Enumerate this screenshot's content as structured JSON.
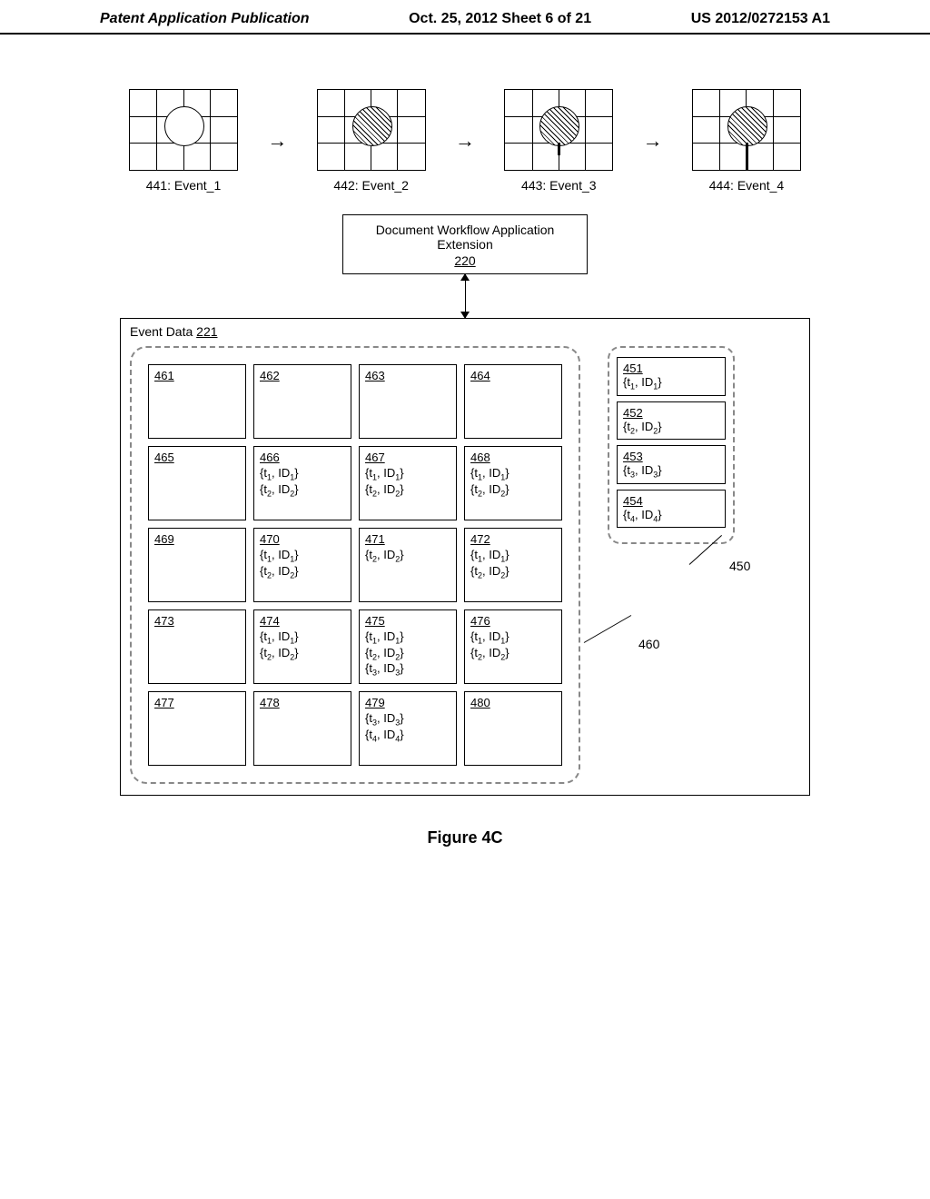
{
  "header": {
    "left": "Patent Application Publication",
    "center": "Oct. 25, 2012  Sheet 6 of 21",
    "right": "US 2012/0272153 A1"
  },
  "events": [
    {
      "label": "441: Event_1",
      "hatched": false,
      "stem": "none"
    },
    {
      "label": "442: Event_2",
      "hatched": true,
      "stem": "none"
    },
    {
      "label": "443: Event_3",
      "hatched": true,
      "stem": "short"
    },
    {
      "label": "444: Event_4",
      "hatched": true,
      "stem": "long"
    }
  ],
  "workflow": {
    "title": "Document Workflow Application Extension",
    "number": "220"
  },
  "event_data": {
    "title": "Event Data",
    "number": "221"
  },
  "cells460": [
    [
      {
        "num": "461",
        "rows": []
      },
      {
        "num": "462",
        "rows": []
      },
      {
        "num": "463",
        "rows": []
      },
      {
        "num": "464",
        "rows": []
      }
    ],
    [
      {
        "num": "465",
        "rows": []
      },
      {
        "num": "466",
        "rows": [
          "{t₁, ID₁}",
          "{t₂, ID₂}"
        ]
      },
      {
        "num": "467",
        "rows": [
          "{t₁, ID₁}",
          "{t₂, ID₂}"
        ]
      },
      {
        "num": "468",
        "rows": [
          "{t₁, ID₁}",
          "{t₂, ID₂}"
        ]
      }
    ],
    [
      {
        "num": "469",
        "rows": []
      },
      {
        "num": "470",
        "rows": [
          "{t₁, ID₁}",
          "{t₂, ID₂}"
        ]
      },
      {
        "num": "471",
        "rows": [
          "{t₂, ID₂}"
        ]
      },
      {
        "num": "472",
        "rows": [
          "{t₁, ID₁}",
          "{t₂, ID₂}"
        ]
      }
    ],
    [
      {
        "num": "473",
        "rows": []
      },
      {
        "num": "474",
        "rows": [
          "{t₁, ID₁}",
          "{t₂, ID₂}"
        ]
      },
      {
        "num": "475",
        "rows": [
          "{t₁, ID₁}",
          "{t₂, ID₂}",
          "{t₃, ID₃}"
        ]
      },
      {
        "num": "476",
        "rows": [
          "{t₁, ID₁}",
          "{t₂, ID₂}"
        ]
      }
    ],
    [
      {
        "num": "477",
        "rows": []
      },
      {
        "num": "478",
        "rows": []
      },
      {
        "num": "479",
        "rows": [
          "{t₃, ID₃}",
          "{t₄, ID₄}"
        ]
      },
      {
        "num": "480",
        "rows": []
      }
    ]
  ],
  "cells450": [
    {
      "num": "451",
      "rows": [
        "{t₁, ID₁}"
      ]
    },
    {
      "num": "452",
      "rows": [
        "{t₂, ID₂}"
      ]
    },
    {
      "num": "453",
      "rows": [
        "{t₃, ID₃}"
      ]
    },
    {
      "num": "454",
      "rows": [
        "{t₄, ID₄}"
      ]
    }
  ],
  "callouts": {
    "c460": "460",
    "c450": "450"
  },
  "figure_caption": "Figure 4C",
  "chart_data": {
    "type": "table",
    "description": "Patent figure 4C: four sequential event snapshots (441–444) showing a circle on a 4×3 grid, a Document Workflow Application Extension box (220) linked to an Event Data container (221). The container holds a dashed 4×5 grid of cells (460: cells 461–480) and a dashed vertical list (450: cells 451–454). Each cell lists tuples {t_i, ID_i}.",
    "region_460_cells": [
      {
        "id": 461,
        "tuples": []
      },
      {
        "id": 462,
        "tuples": []
      },
      {
        "id": 463,
        "tuples": []
      },
      {
        "id": 464,
        "tuples": []
      },
      {
        "id": 465,
        "tuples": []
      },
      {
        "id": 466,
        "tuples": [
          [
            1,
            1
          ],
          [
            2,
            2
          ]
        ]
      },
      {
        "id": 467,
        "tuples": [
          [
            1,
            1
          ],
          [
            2,
            2
          ]
        ]
      },
      {
        "id": 468,
        "tuples": [
          [
            1,
            1
          ],
          [
            2,
            2
          ]
        ]
      },
      {
        "id": 469,
        "tuples": []
      },
      {
        "id": 470,
        "tuples": [
          [
            1,
            1
          ],
          [
            2,
            2
          ]
        ]
      },
      {
        "id": 471,
        "tuples": [
          [
            2,
            2
          ]
        ]
      },
      {
        "id": 472,
        "tuples": [
          [
            1,
            1
          ],
          [
            2,
            2
          ]
        ]
      },
      {
        "id": 473,
        "tuples": []
      },
      {
        "id": 474,
        "tuples": [
          [
            1,
            1
          ],
          [
            2,
            2
          ]
        ]
      },
      {
        "id": 475,
        "tuples": [
          [
            1,
            1
          ],
          [
            2,
            2
          ],
          [
            3,
            3
          ]
        ]
      },
      {
        "id": 476,
        "tuples": [
          [
            1,
            1
          ],
          [
            2,
            2
          ]
        ]
      },
      {
        "id": 477,
        "tuples": []
      },
      {
        "id": 478,
        "tuples": []
      },
      {
        "id": 479,
        "tuples": [
          [
            3,
            3
          ],
          [
            4,
            4
          ]
        ]
      },
      {
        "id": 480,
        "tuples": []
      }
    ],
    "region_450_cells": [
      {
        "id": 451,
        "tuples": [
          [
            1,
            1
          ]
        ]
      },
      {
        "id": 452,
        "tuples": [
          [
            2,
            2
          ]
        ]
      },
      {
        "id": 453,
        "tuples": [
          [
            3,
            3
          ]
        ]
      },
      {
        "id": 454,
        "tuples": [
          [
            4,
            4
          ]
        ]
      }
    ],
    "events": [
      {
        "id": 441,
        "name": "Event_1",
        "filled": false,
        "stem": false
      },
      {
        "id": 442,
        "name": "Event_2",
        "filled": true,
        "stem": false
      },
      {
        "id": 443,
        "name": "Event_3",
        "filled": true,
        "stem": true
      },
      {
        "id": 444,
        "name": "Event_4",
        "filled": true,
        "stem": true
      }
    ]
  }
}
